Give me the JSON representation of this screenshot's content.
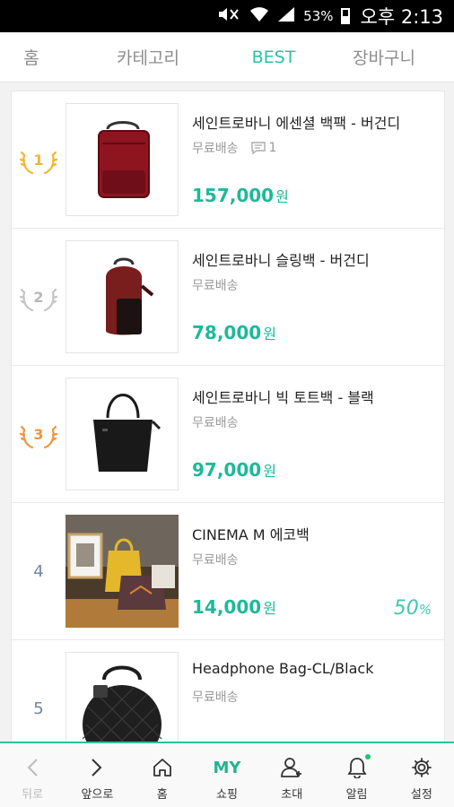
{
  "status_bar": {
    "battery": "53%",
    "time": "오후 2:13",
    "icons": [
      "mute-icon",
      "wifi-icon",
      "signal-icon",
      "battery-icon"
    ]
  },
  "tabs": [
    {
      "label": "홈",
      "active": false
    },
    {
      "label": "카테고리",
      "active": false
    },
    {
      "label": "BEST",
      "active": true
    },
    {
      "label": "장바구니",
      "active": false
    }
  ],
  "products": [
    {
      "rank": "1",
      "medal": "gold",
      "title": "세인트로바니 에센셜 백팩 - 버건디",
      "shipping": "무료배송",
      "reviews": "1",
      "price": "157,000",
      "currency": "원",
      "discount": ""
    },
    {
      "rank": "2",
      "medal": "silver",
      "title": "세인트로바니 슬링백 - 버건디",
      "shipping": "무료배송",
      "reviews": "",
      "price": "78,000",
      "currency": "원",
      "discount": ""
    },
    {
      "rank": "3",
      "medal": "bronze",
      "title": "세인트로바니 빅 토트백 - 블랙",
      "shipping": "무료배송",
      "reviews": "",
      "price": "97,000",
      "currency": "원",
      "discount": ""
    },
    {
      "rank": "4",
      "medal": "",
      "title": "CINEMA M 에코백",
      "shipping": "무료배송",
      "reviews": "",
      "price": "14,000",
      "currency": "원",
      "discount": "50",
      "discount_unit": "%"
    },
    {
      "rank": "5",
      "medal": "",
      "title": "Headphone Bag-CL/Black",
      "shipping": "무료배송",
      "reviews": "",
      "price": "",
      "currency": "",
      "discount": ""
    }
  ],
  "bottom_nav": [
    {
      "label": "뒤로",
      "icon": "back-chevron-icon"
    },
    {
      "label": "앞으로",
      "icon": "forward-chevron-icon"
    },
    {
      "label": "홈",
      "icon": "home-icon"
    },
    {
      "label": "쇼핑",
      "icon": "my-text",
      "icon_text": "MY"
    },
    {
      "label": "초대",
      "icon": "add-user-icon"
    },
    {
      "label": "알림",
      "icon": "bell-icon"
    },
    {
      "label": "설정",
      "icon": "gear-icon"
    }
  ],
  "colors": {
    "accent": "#27c2a5",
    "price": "#1eb999",
    "gold": "#f0b62e",
    "silver": "#c4c4c4",
    "bronze": "#ee9540"
  }
}
